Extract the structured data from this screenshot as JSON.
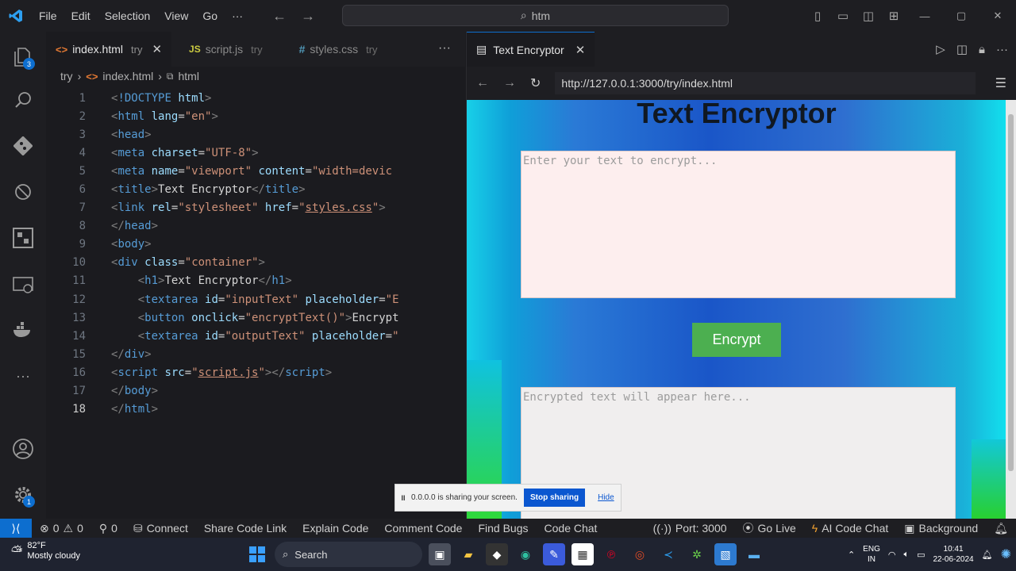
{
  "menu": {
    "items": [
      "File",
      "Edit",
      "Selection",
      "View",
      "Go"
    ],
    "more": "···",
    "search_text": "htm"
  },
  "activity": {
    "explorer_badge": "3",
    "settings_badge": "1"
  },
  "tabs": [
    {
      "icon": "<>",
      "name": "index.html",
      "sub": "try"
    },
    {
      "icon": "JS",
      "name": "script.js",
      "sub": "try"
    },
    {
      "icon": "#",
      "name": "styles.css",
      "sub": "try"
    }
  ],
  "breadcrumb": {
    "folder": "try",
    "file": "index.html",
    "symbol": "html"
  },
  "code": {
    "line_numbers": [
      "1",
      "2",
      "3",
      "4",
      "5",
      "6",
      "7",
      "8",
      "9",
      "10",
      "11",
      "12",
      "13",
      "14",
      "15",
      "16",
      "17",
      "18"
    ]
  },
  "preview": {
    "tab_title": "Text Encryptor",
    "url": "http://127.0.0.1:3000/try/index.html",
    "heading": "Text Encryptor",
    "input_placeholder": "Enter your text to encrypt...",
    "button_label": "Encrypt",
    "output_placeholder": "Encrypted text will appear here..."
  },
  "share_bar": {
    "message": "0.0.0.0 is sharing your screen.",
    "stop_label": "Stop sharing",
    "hide_label": "Hide"
  },
  "status": {
    "errors": "0",
    "warnings": "0",
    "ports": "0",
    "items": [
      "Connect",
      "Share Code Link",
      "Explain Code",
      "Comment Code",
      "Find Bugs",
      "Code Chat"
    ],
    "port": "Port: 3000",
    "go_live": "Go Live",
    "ai_chat": "AI Code Chat",
    "background": "Background"
  },
  "taskbar": {
    "temp": "82°F",
    "weather": "Mostly cloudy",
    "search": "Search",
    "lang1": "ENG",
    "lang2": "IN",
    "time": "10:41",
    "date": "22-06-2024"
  }
}
